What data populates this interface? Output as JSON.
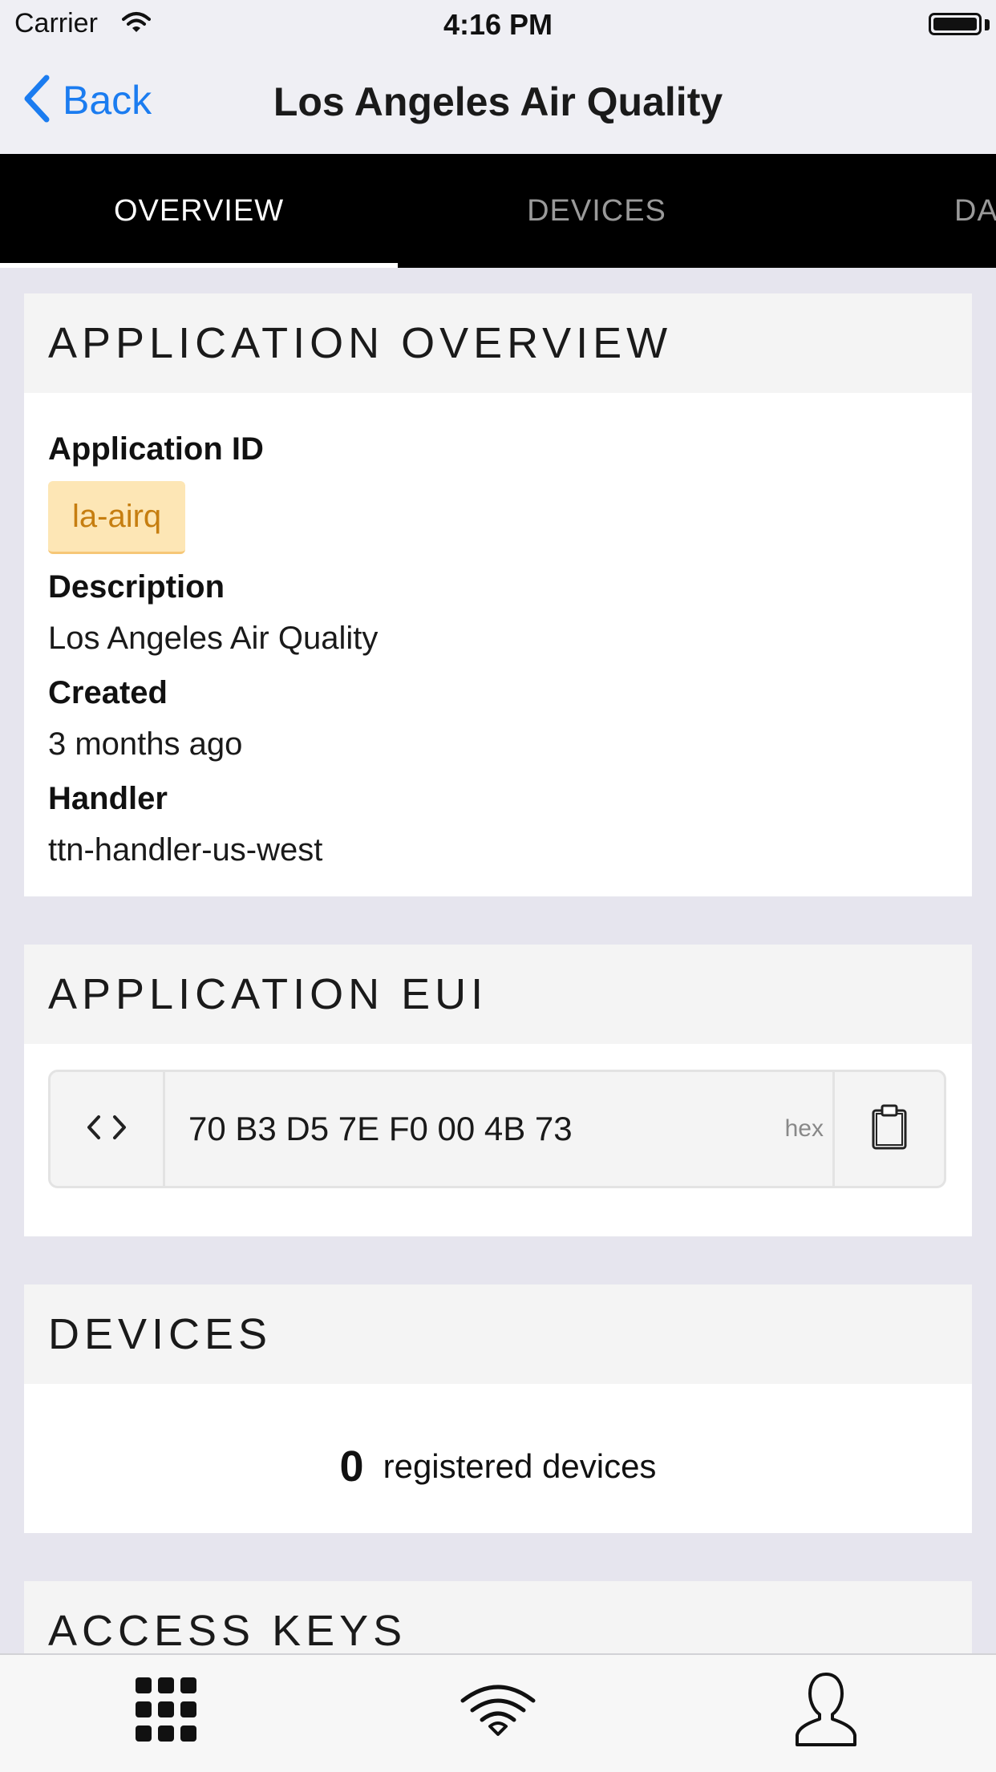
{
  "status_bar": {
    "carrier": "Carrier",
    "time": "4:16 PM"
  },
  "nav": {
    "back_label": "Back",
    "title": "Los Angeles Air Quality"
  },
  "tabs": [
    {
      "label": "OVERVIEW",
      "active": true
    },
    {
      "label": "DEVICES",
      "active": false
    },
    {
      "label": "DATA",
      "active": false
    }
  ],
  "overview": {
    "header": "APPLICATION OVERVIEW",
    "app_id_label": "Application ID",
    "app_id": "la-airq",
    "description_label": "Description",
    "description": "Los Angeles Air Quality",
    "created_label": "Created",
    "created": "3 months ago",
    "handler_label": "Handler",
    "handler": "ttn-handler-us-west"
  },
  "eui": {
    "header": "APPLICATION EUI",
    "value": "70 B3 D5 7E F0 00 4B 73",
    "format": "hex"
  },
  "devices": {
    "header": "DEVICES",
    "count": "0",
    "label": "registered devices"
  },
  "access_keys": {
    "header": "ACCESS KEYS"
  },
  "bottom_bar": {
    "icons": [
      "grid-icon",
      "wifi-icon",
      "user-icon"
    ]
  },
  "colors": {
    "accent": "#1b7cf0",
    "badge_bg": "#fde6b5",
    "badge_text": "#c67e10",
    "tab_bg": "#000000"
  }
}
